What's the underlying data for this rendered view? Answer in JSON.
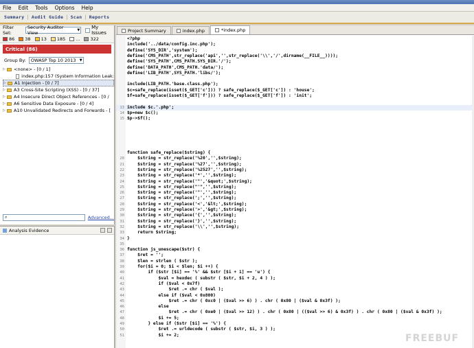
{
  "menu": [
    "File",
    "Edit",
    "Tools",
    "Options",
    "Help"
  ],
  "perspectives": [
    "Summary",
    "Audit Guide",
    "Scan",
    "Reports"
  ],
  "filter": {
    "label": "Filter Set:",
    "value": "Security Auditor View",
    "my_issues": "My Issues"
  },
  "counts": [
    {
      "value": "86",
      "color": "#d32f2f"
    },
    {
      "value": "38",
      "color": "#f57c00"
    },
    {
      "value": "13",
      "color": "#fbc02d"
    },
    {
      "value": "185",
      "color": "#ffe082"
    },
    {
      "value": "...",
      "color": "#ffffff"
    },
    {
      "value": "322",
      "color": "#9e9e9e"
    }
  ],
  "critical": "Critical (86)",
  "group": {
    "label": "Group By:",
    "value": "OWASP Top 10 2013"
  },
  "tree": [
    {
      "label": "<none> - [0 / 1]",
      "level": 0,
      "type": "folder"
    },
    {
      "label": "index.php:157 (System Information Leak:",
      "level": 1,
      "type": "file"
    },
    {
      "label": "A1 Injection - [0 / 7]",
      "level": 0,
      "type": "folder",
      "selected": true
    },
    {
      "label": "A3 Cross-Site Scripting (XSS) - [0 / 37]",
      "level": 0,
      "type": "folder"
    },
    {
      "label": "A4 Insecure Direct Object References - [0 /",
      "level": 0,
      "type": "folder"
    },
    {
      "label": "A6 Sensitive Data Exposure - [0 / 4]",
      "level": 0,
      "type": "folder"
    },
    {
      "label": "A10 Unvalidated Redirects and Forwards - [",
      "level": 0,
      "type": "folder"
    }
  ],
  "advanced": "Advanced...",
  "evidence_title": "Analysis Evidence",
  "tabs": [
    {
      "label": "Project Summary",
      "active": false
    },
    {
      "label": "index.php",
      "active": false
    },
    {
      "label": "*index.php",
      "active": true
    }
  ],
  "code_lines": [
    {
      "n": "",
      "t": "<?php"
    },
    {
      "n": "",
      "t": "include('../data/config.inc.php');"
    },
    {
      "n": "",
      "t": "define('SYS_DIR','system');"
    },
    {
      "n": "",
      "t": "define('CMS_PATH',str_replace('api','',str_replace('\\\\','/',dirname(__FILE__))));"
    },
    {
      "n": "",
      "t": "define('SYS_PATH',CMS_PATH.SYS_DIR.'/');"
    },
    {
      "n": "",
      "t": "define('DATA_PATH',CMS_PATH.'data/');"
    },
    {
      "n": "",
      "t": "define('LIB_PATH',SYS_PATH.'libs/');"
    },
    {
      "n": "",
      "t": ""
    },
    {
      "n": "",
      "t": "include(LIB_PATH.'base.class.php');"
    },
    {
      "n": "",
      "t": "$c=safe_replace(isset($_GET['c'])) ? safe_replace($_GET['c']) : 'house';"
    },
    {
      "n": "",
      "t": "$f=safe_replace(isset($_GET['f'])) ? safe_replace($_GET['f']) : 'init';"
    },
    {
      "n": "",
      "t": ""
    },
    {
      "n": "13",
      "t": "include $c.'.php';"
    },
    {
      "n": "14",
      "t": "$p=new $c();"
    },
    {
      "n": "15",
      "t": "$p->$f();"
    },
    {
      "n": "",
      "t": ""
    },
    {
      "n": "",
      "t": ""
    },
    {
      "n": "",
      "t": ""
    },
    {
      "n": "",
      "t": ""
    },
    {
      "n": "",
      "t": ""
    },
    {
      "n": "",
      "t": "function safe_replace($string) {"
    },
    {
      "n": "20",
      "t": "    $string = str_replace('%20','',$string);"
    },
    {
      "n": "21",
      "t": "    $string = str_replace('%27','',$string);"
    },
    {
      "n": "22",
      "t": "    $string = str_replace('%2527','',$string);"
    },
    {
      "n": "23",
      "t": "    $string = str_replace('*','',$string);"
    },
    {
      "n": "24",
      "t": "    $string = str_replace('\"','&quot;',$string);"
    },
    {
      "n": "25",
      "t": "    $string = str_replace(\"'\",'',$string);"
    },
    {
      "n": "26",
      "t": "    $string = str_replace('\"','',$string);"
    },
    {
      "n": "27",
      "t": "    $string = str_replace(';','',$string);"
    },
    {
      "n": "28",
      "t": "    $string = str_replace('<','&lt;',$string);"
    },
    {
      "n": "29",
      "t": "    $string = str_replace('>','&gt;',$string);"
    },
    {
      "n": "30",
      "t": "    $string = str_replace('{','',$string);"
    },
    {
      "n": "31",
      "t": "    $string = str_replace('}','',$string);"
    },
    {
      "n": "32",
      "t": "    $string = str_replace('\\\\','',$string);"
    },
    {
      "n": "33",
      "t": "    return $string;"
    },
    {
      "n": "34",
      "t": "}"
    },
    {
      "n": "35",
      "t": ""
    },
    {
      "n": "36",
      "t": "function js_unescape($str) {"
    },
    {
      "n": "37",
      "t": "    $ret = '';"
    },
    {
      "n": "38",
      "t": "    $len = strlen ( $str );"
    },
    {
      "n": "39",
      "t": "    for($i = 0; $i < $len; $i ++) {"
    },
    {
      "n": "40",
      "t": "        if ($str [$i] == '%' && $str [$i + 1] == 'u') {"
    },
    {
      "n": "41",
      "t": "            $val = hexdec ( substr ( $str, $i + 2, 4 ) );"
    },
    {
      "n": "42",
      "t": "            if ($val < 0x7f)"
    },
    {
      "n": "43",
      "t": "                $ret .= chr ( $val );"
    },
    {
      "n": "44",
      "t": "            else if ($val < 0x800)"
    },
    {
      "n": "45",
      "t": "                $ret .= chr ( 0xc0 | ($val >> 6) ) . chr ( 0x80 | ($val & 0x3f) );"
    },
    {
      "n": "46",
      "t": "            else"
    },
    {
      "n": "47",
      "t": "                $ret .= chr ( 0xe0 | ($val >> 12) ) . chr ( 0x80 | (($val >> 6) & 0x3f) ) . chr ( 0x80 | ($val & 0x3f) );"
    },
    {
      "n": "48",
      "t": "            $i += 5;"
    },
    {
      "n": "49",
      "t": "        } else if ($str [$i] == '%') {"
    },
    {
      "n": "50",
      "t": "            $ret .= urldecode ( substr ( $str, $i, 3 ) );"
    },
    {
      "n": "51",
      "t": "            $i += 2;"
    }
  ],
  "watermark": "FREEBUF"
}
